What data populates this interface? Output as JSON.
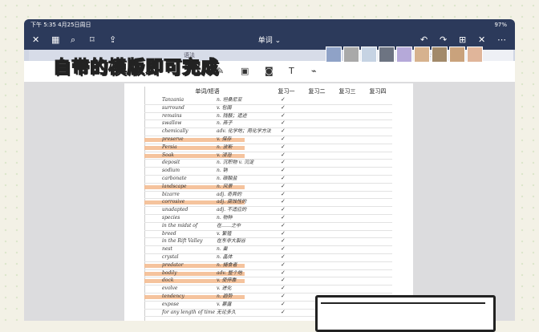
{
  "status": {
    "time_date": "下午 5:35  4月25日周日",
    "battery": "97%"
  },
  "nav": {
    "title": "单词 ⌄"
  },
  "tabs": [
    {
      "label": "语法"
    },
    {
      "label": "单词"
    }
  ],
  "overlay_text": "自带的模版即可完成",
  "table": {
    "headers": [
      "单词/短语",
      "复习一",
      "复习二",
      "复习三",
      "复习四"
    ],
    "rows": [
      {
        "word": "Tanzania",
        "mean": "n. 坦桑尼亚",
        "chk": "✓",
        "hl": false
      },
      {
        "word": "surround",
        "mean": "v. 包围",
        "chk": "✓",
        "hl": false
      },
      {
        "word": "remains",
        "mean": "n. 残骸；遗迹",
        "chk": "✓",
        "hl": false
      },
      {
        "word": "swallow",
        "mean": "n. 燕子",
        "chk": "✓",
        "hl": false
      },
      {
        "word": "chemically",
        "mean": "adv. 化学地；用化学方法",
        "chk": "✓",
        "hl": false
      },
      {
        "word": "preserve",
        "mean": "v. 保存",
        "chk": "✓",
        "hl": true
      },
      {
        "word": "Persia",
        "mean": "n. 波斯",
        "chk": "✓",
        "hl": true
      },
      {
        "word": "Soak",
        "mean": "v. 浸泡",
        "chk": "✓",
        "hl": true
      },
      {
        "word": "deposit",
        "mean": "n. 沉积物 v. 沉淀",
        "chk": "✓",
        "hl": false
      },
      {
        "word": "sodium",
        "mean": "n. 钠",
        "chk": "✓",
        "hl": false
      },
      {
        "word": "carbonate",
        "mean": "n. 碳酸盐",
        "chk": "✓",
        "hl": false
      },
      {
        "word": "landscape",
        "mean": "n. 风景",
        "chk": "✓",
        "hl": true
      },
      {
        "word": "bizarre",
        "mean": "adj. 奇异的",
        "chk": "✓",
        "hl": false
      },
      {
        "word": "corrosive",
        "mean": "adj. 腐蚀性的",
        "chk": "✓",
        "hl": true
      },
      {
        "word": "unadapted",
        "mean": "adj. 不适应的",
        "chk": "✓",
        "hl": false
      },
      {
        "word": "species",
        "mean": "n. 物种",
        "chk": "✓",
        "hl": false
      },
      {
        "word": "in the midst of",
        "mean": "在……之中",
        "chk": "✓",
        "hl": false
      },
      {
        "word": "breed",
        "mean": "v. 繁殖",
        "chk": "✓",
        "hl": false
      },
      {
        "word": "in the Rift Valley",
        "mean": "在东非大裂谷",
        "chk": "✓",
        "hl": false
      },
      {
        "word": "nest",
        "mean": "n. 巢",
        "chk": "✓",
        "hl": false
      },
      {
        "word": "crystal",
        "mean": "n. 晶体",
        "chk": "✓",
        "hl": false
      },
      {
        "word": "predator",
        "mean": "n. 捕食者",
        "chk": "✓",
        "hl": true
      },
      {
        "word": "bodily",
        "mean": "adv. 整个地",
        "chk": "✓",
        "hl": true
      },
      {
        "word": "dock",
        "mean": "v. 使停靠",
        "chk": "✓",
        "hl": true
      },
      {
        "word": "evolve",
        "mean": "v. 进化",
        "chk": "✓",
        "hl": false
      },
      {
        "word": "tendency",
        "mean": "n. 趋势",
        "chk": "✓",
        "hl": true
      },
      {
        "word": "expose",
        "mean": "v. 暴露",
        "chk": "✓",
        "hl": false
      },
      {
        "word": "for any length of time",
        "mean": "无论多久",
        "chk": "✓",
        "hl": false
      }
    ]
  }
}
